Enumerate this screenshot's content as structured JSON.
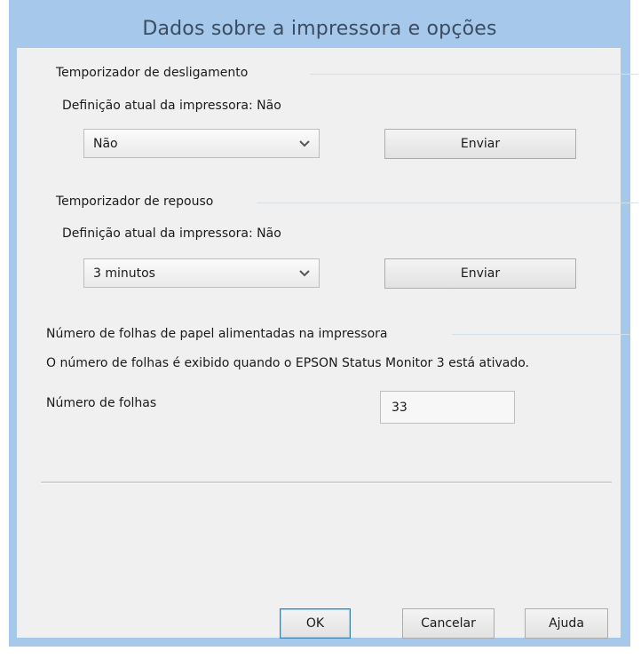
{
  "window": {
    "title": "Dados sobre a impressora e opções"
  },
  "shutdown_timer": {
    "heading": "Temporizador de desligamento",
    "current_setting": "Definição atual da impressora: Não",
    "selected": "Não",
    "send_label": "Enviar"
  },
  "sleep_timer": {
    "heading": "Temporizador de repouso",
    "current_setting": "Definição atual da impressora: Não",
    "selected": "3 minutos",
    "send_label": "Enviar"
  },
  "sheets": {
    "heading": "Número de folhas de papel alimentadas na impressora",
    "note": "O número de folhas é exibido quando o EPSON Status Monitor 3 está ativado.",
    "label": "Número de folhas",
    "value": "33"
  },
  "footer": {
    "ok_label": "OK",
    "cancel_label": "Cancelar",
    "help_label": "Ajuda"
  },
  "colors": {
    "frame": "#a6c9eb",
    "client": "#f0f0f0",
    "title_text": "#3b4c62",
    "default_button_border": "#3c7fb1"
  },
  "icons": {
    "combo_arrow": "chevron-down-icon"
  }
}
